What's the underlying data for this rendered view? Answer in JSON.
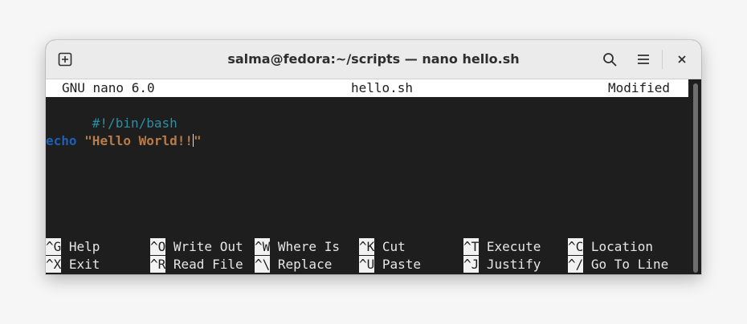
{
  "window": {
    "title": "salma@fedora:~/scripts — nano hello.sh"
  },
  "titlebar": {
    "icons": [
      "new-tab-icon",
      "search-icon",
      "menu-icon",
      "close-icon"
    ]
  },
  "nano": {
    "header": {
      "version": "GNU nano 6.0",
      "filename": "hello.sh",
      "status": "Modified"
    },
    "lines": {
      "shebang": "#!/bin/bash",
      "echo_keyword": "echo",
      "echo_string": "\"Hello World!!",
      "echo_string_end": "\""
    },
    "shortcuts": [
      {
        "key": "^G",
        "label": " Help"
      },
      {
        "key": "^O",
        "label": " Write Out"
      },
      {
        "key": "^W",
        "label": " Where Is"
      },
      {
        "key": "^K",
        "label": " Cut"
      },
      {
        "key": "^T",
        "label": " Execute"
      },
      {
        "key": "^C",
        "label": " Location"
      },
      {
        "key": "^X",
        "label": " Exit"
      },
      {
        "key": "^R",
        "label": " Read File"
      },
      {
        "key": "^\\",
        "label": " Replace"
      },
      {
        "key": "^U",
        "label": " Paste"
      },
      {
        "key": "^J",
        "label": " Justify"
      },
      {
        "key": "^/",
        "label": " Go To Line"
      }
    ]
  },
  "colors": {
    "shebang": "#2a8fa3",
    "keyword": "#1f5fb5",
    "string": "#b87c4a",
    "terminal_bg": "#1e1e1e"
  }
}
